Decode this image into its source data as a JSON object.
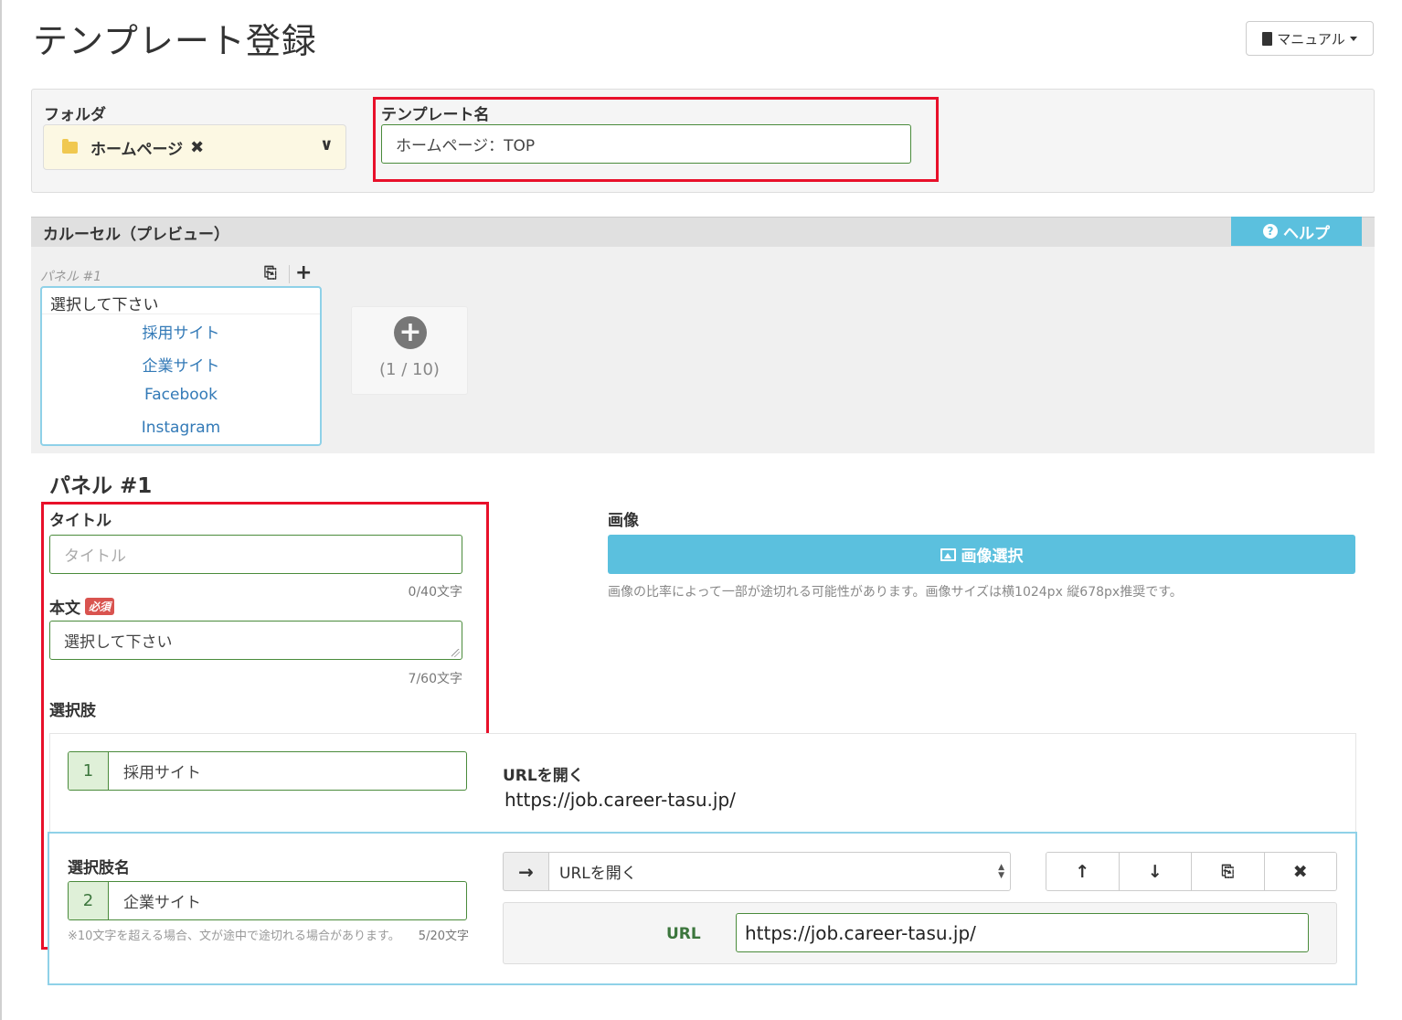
{
  "page": {
    "title": "テンプレート登録"
  },
  "manual": {
    "label": "マニュアル"
  },
  "folder": {
    "label": "フォルダ",
    "value": "ホームページ"
  },
  "template_name": {
    "label": "テンプレート名",
    "value": "ホームページ：TOP"
  },
  "carousel": {
    "header": "カルーセル（プレビュー）",
    "help_label": "ヘルプ",
    "panel_tab": "パネル #1",
    "preview": {
      "text": "選択して下さい",
      "choices": [
        "採用サイト",
        "企業サイト",
        "Facebook",
        "Instagram"
      ]
    },
    "add_count": "(1 / 10)"
  },
  "panel": {
    "title": "パネル #1",
    "title_field": {
      "label": "タイトル",
      "placeholder": "タイトル",
      "counter": "0/40文字"
    },
    "body_field": {
      "label": "本文",
      "required": "必須",
      "value": "選択して下さい",
      "counter": "7/60文字"
    },
    "image": {
      "label": "画像",
      "button": "画像選択",
      "note": "画像の比率によって一部が途切れる可能性があります。画像サイズは横1024px 縦678px推奨です。"
    },
    "choices_label": "選択肢",
    "choice1": {
      "num": "1",
      "name": "採用サイト",
      "action": "URLを開く",
      "url": "https://job.career-tasu.jp/"
    },
    "choice2": {
      "label": "選択肢名",
      "num": "2",
      "name": "企業サイト",
      "action": "URLを開く",
      "url_label": "URL",
      "url": "https://job.career-tasu.jp/",
      "note": "※10文字を超える場合、文が途中で途切れる場合があります。",
      "counter": "5/20文字"
    }
  }
}
